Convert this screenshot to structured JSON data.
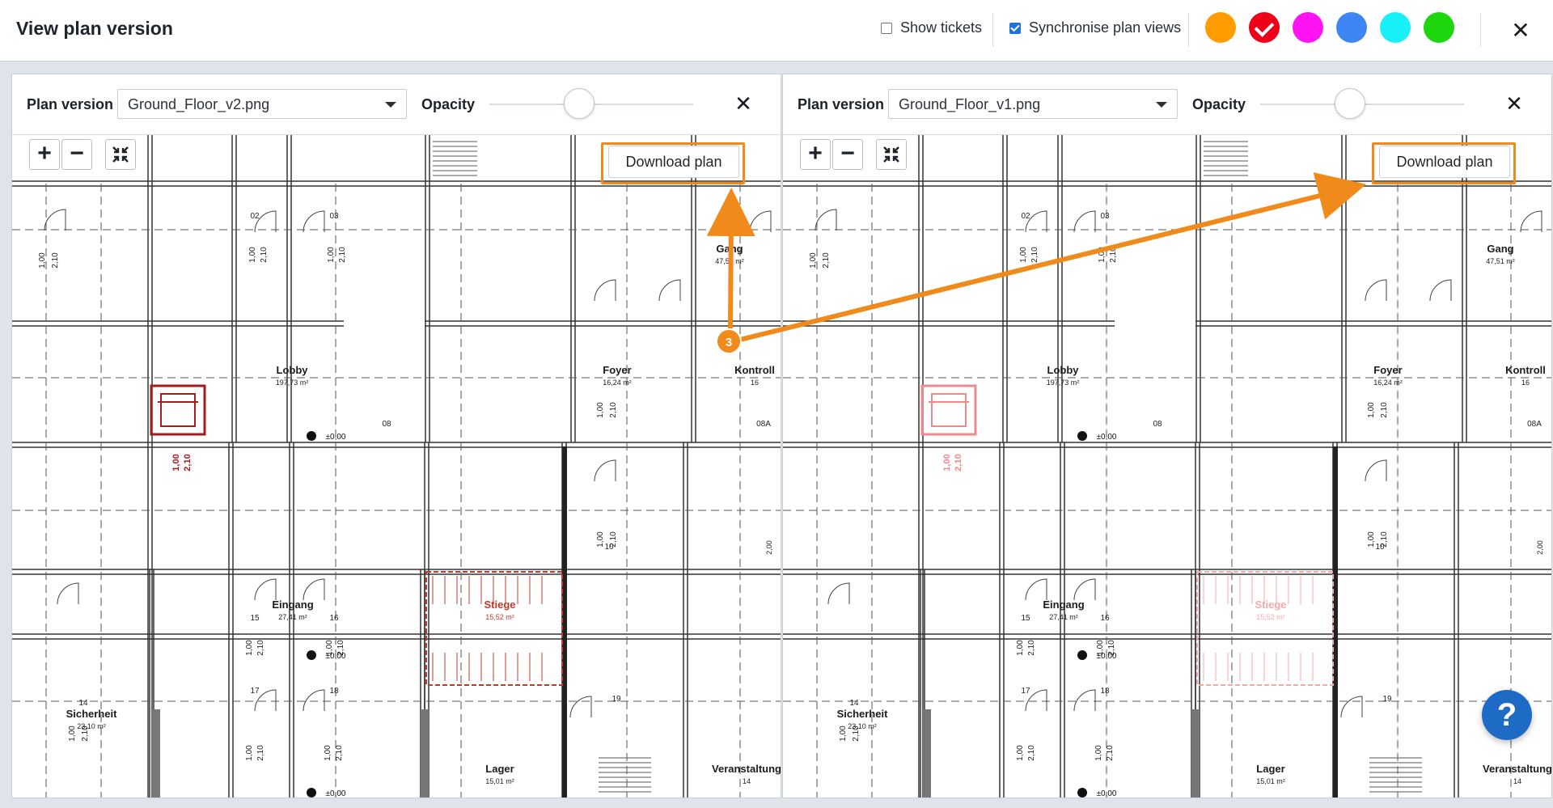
{
  "dialog": {
    "title": "View plan version",
    "show_tickets_label": "Show tickets",
    "show_tickets_checked": false,
    "sync_label": "Synchronise plan views",
    "sync_checked": true,
    "colors": [
      "#ff9c00",
      "#ef0019",
      "#ff13f3",
      "#3d86f3",
      "#18f0f8",
      "#1ed60d"
    ],
    "selected_color_index": 1,
    "close_glyph": "✕"
  },
  "left_panel": {
    "plan_version_label": "Plan version",
    "plan_file": "Ground_Floor_v2.png",
    "opacity_label": "Opacity",
    "opacity": 0.4,
    "close_glyph": "✕",
    "download_label": "Download plan"
  },
  "right_panel": {
    "plan_version_label": "Plan version",
    "plan_file": "Ground_Floor_v1.png",
    "opacity_label": "Opacity",
    "opacity": 0.4,
    "close_glyph": "✕",
    "download_label": "Download plan"
  },
  "floorplan": {
    "rooms": [
      {
        "name": "Lobby",
        "area": "197,73 m²"
      },
      {
        "name": "Foyer",
        "area": "16,24 m²"
      },
      {
        "name": "Kontroll",
        "area": "16"
      },
      {
        "name": "Gang",
        "area": "47,51 m²"
      },
      {
        "name": "Eingang",
        "area": "27,41 m²"
      },
      {
        "name": "Stiege",
        "area": "15,52 m²"
      },
      {
        "name": "Sicherheit",
        "area": "23,10 m²"
      },
      {
        "name": "Lager",
        "area": "15,01 m²"
      },
      {
        "name": "Veranstaltung",
        "area": "14"
      }
    ],
    "door_numbers": [
      "02",
      "03",
      "08",
      "08A",
      "10",
      "15",
      "16",
      "17",
      "18",
      "14",
      "19"
    ],
    "level_mark": "±0,00",
    "dims": [
      "1,00",
      "2,10",
      "2,00"
    ]
  },
  "annotation": {
    "step": "3",
    "color": "#f08a1b"
  },
  "help": {
    "glyph": "?"
  }
}
